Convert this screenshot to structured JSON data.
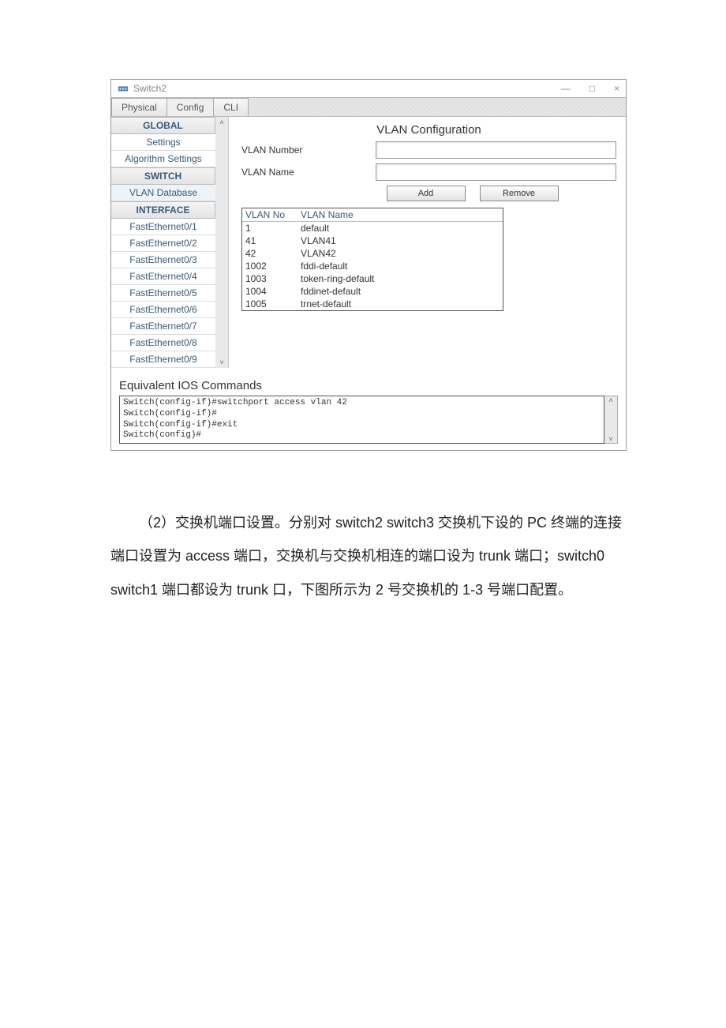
{
  "window": {
    "title": "Switch2",
    "controls": {
      "min": "—",
      "max": "□",
      "close": "×"
    }
  },
  "tabs": [
    "Physical",
    "Config",
    "CLI"
  ],
  "sidebar": {
    "sections": [
      {
        "header": "GLOBAL",
        "items": [
          "Settings",
          "Algorithm Settings"
        ]
      },
      {
        "header": "SWITCH",
        "items": [
          "VLAN Database"
        ]
      },
      {
        "header": "INTERFACE",
        "items": [
          "FastEthernet0/1",
          "FastEthernet0/2",
          "FastEthernet0/3",
          "FastEthernet0/4",
          "FastEthernet0/5",
          "FastEthernet0/6",
          "FastEthernet0/7",
          "FastEthernet0/8",
          "FastEthernet0/9"
        ]
      }
    ],
    "scroll": {
      "up": "˄",
      "down": "˅"
    }
  },
  "main": {
    "title": "VLAN Configuration",
    "vlan_number_label": "VLAN Number",
    "vlan_name_label": "VLAN Name",
    "add_label": "Add",
    "remove_label": "Remove",
    "table": {
      "headers": [
        "VLAN No",
        "VLAN Name"
      ],
      "rows": [
        [
          "1",
          "default"
        ],
        [
          "41",
          "VLAN41"
        ],
        [
          "42",
          "VLAN42"
        ],
        [
          "1002",
          "fddi-default"
        ],
        [
          "1003",
          "token-ring-default"
        ],
        [
          "1004",
          "fddinet-default"
        ],
        [
          "1005",
          "trnet-default"
        ]
      ]
    }
  },
  "ios": {
    "title": "Equivalent IOS Commands",
    "lines": [
      "Switch(config-if)#switchport access vlan 42",
      "Switch(config-if)#",
      "Switch(config-if)#exit",
      "Switch(config)#"
    ]
  },
  "doc": {
    "paragraph": "（2）交换机端口设置。分别对 switch2 switch3 交换机下设的 PC 终端的连接端口设置为 access 端口，交换机与交换机相连的端口设为 trunk 端口；switch0 switch1 端口都设为 trunk 口，下图所示为 2 号交换机的 1-3 号端口配置。"
  }
}
